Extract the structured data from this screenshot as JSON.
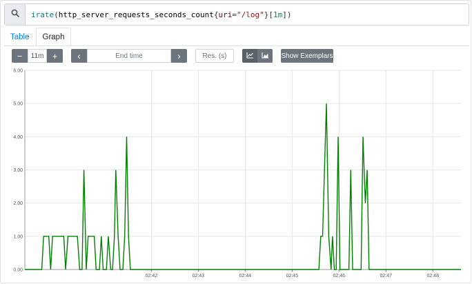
{
  "query": {
    "function": "irate",
    "metric": "http_server_requests_seconds_count",
    "label_name": "uri",
    "label_value": "\"/log\"",
    "range": "1m"
  },
  "tabs": [
    {
      "label": "Table",
      "active": false
    },
    {
      "label": "Graph",
      "active": true
    }
  ],
  "controls": {
    "minus_label": "−",
    "range_value": "11m",
    "plus_label": "+",
    "prev_label": "‹",
    "end_time_placeholder": "End time",
    "next_label": "›",
    "resolution_placeholder": "Res. (s)",
    "show_exemplars_label": "Show Exemplars",
    "line_mode_icon": "line-chart-icon",
    "stacked_mode_icon": "area-chart-icon"
  },
  "colors": {
    "series": "#008000",
    "grid": "#e6e6e6",
    "accent": "#007bff",
    "button": "#6c757d"
  },
  "chart_data": {
    "type": "line",
    "ylim": [
      0,
      6
    ],
    "y_ticks": [
      "0.00",
      "1.00",
      "2.00",
      "3.00",
      "4.00",
      "5.00",
      "6.00"
    ],
    "x_ticks": [
      "02:42",
      "02:43",
      "02:44",
      "02:45",
      "02:46",
      "02:47",
      "02:48"
    ],
    "x_tick_minutes": [
      2.7,
      3.7,
      4.7,
      5.7,
      6.7,
      7.7,
      8.7
    ],
    "xlim_minutes": [
      0,
      9.3
    ],
    "grid": true,
    "series": [
      {
        "points": [
          [
            0.0,
            0
          ],
          [
            0.36,
            0
          ],
          [
            0.4,
            1
          ],
          [
            0.51,
            1
          ],
          [
            0.55,
            0
          ],
          [
            0.59,
            1
          ],
          [
            0.83,
            1
          ],
          [
            0.87,
            0
          ],
          [
            0.92,
            1
          ],
          [
            1.12,
            1
          ],
          [
            1.17,
            0
          ],
          [
            1.22,
            0
          ],
          [
            1.26,
            3
          ],
          [
            1.31,
            0
          ],
          [
            1.35,
            1
          ],
          [
            1.48,
            1
          ],
          [
            1.52,
            0
          ],
          [
            1.59,
            0
          ],
          [
            1.63,
            1
          ],
          [
            1.67,
            0
          ],
          [
            1.74,
            0
          ],
          [
            1.78,
            1
          ],
          [
            1.83,
            0
          ],
          [
            1.87,
            0
          ],
          [
            1.91,
            1
          ],
          [
            1.94,
            3
          ],
          [
            1.99,
            1
          ],
          [
            2.03,
            0
          ],
          [
            2.09,
            0
          ],
          [
            2.13,
            1
          ],
          [
            2.17,
            4
          ],
          [
            2.21,
            1
          ],
          [
            2.25,
            0
          ],
          [
            6.27,
            0
          ],
          [
            6.31,
            1
          ],
          [
            6.35,
            1
          ],
          [
            6.39,
            3
          ],
          [
            6.43,
            5
          ],
          [
            6.48,
            1
          ],
          [
            6.53,
            0
          ],
          [
            6.56,
            1
          ],
          [
            6.6,
            0
          ],
          [
            6.64,
            0
          ],
          [
            6.68,
            4
          ],
          [
            6.72,
            0
          ],
          [
            6.91,
            0
          ],
          [
            6.95,
            3
          ],
          [
            6.99,
            0
          ],
          [
            7.17,
            0
          ],
          [
            7.21,
            4
          ],
          [
            7.26,
            2
          ],
          [
            7.3,
            3
          ],
          [
            7.34,
            0
          ],
          [
            9.3,
            0
          ]
        ]
      }
    ]
  }
}
